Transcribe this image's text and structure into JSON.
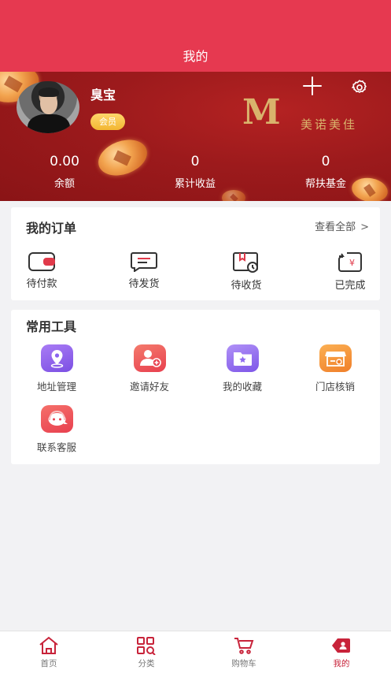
{
  "header": {
    "title": "我的"
  },
  "profile": {
    "name": "臭宝",
    "badge": "会员",
    "brand_letter": "M",
    "brand_name": "美诺美佳"
  },
  "stats": [
    {
      "value": "0.00",
      "label": "余额"
    },
    {
      "value": "0",
      "label": "累计收益"
    },
    {
      "value": "0",
      "label": "帮扶基金"
    }
  ],
  "orders": {
    "title": "我的订单",
    "view_all": "查看全部",
    "items": [
      {
        "label": "待付款",
        "icon": "wallet-icon"
      },
      {
        "label": "待发货",
        "icon": "message-box-icon"
      },
      {
        "label": "待收货",
        "icon": "package-clock-icon"
      },
      {
        "label": "已完成",
        "icon": "refund-yen-icon"
      }
    ]
  },
  "tools": {
    "title": "常用工具",
    "items": [
      {
        "label": "地址管理",
        "icon": "location-icon",
        "color": "#8a63f0"
      },
      {
        "label": "邀请好友",
        "icon": "add-friend-icon",
        "color": "#ef5a5e"
      },
      {
        "label": "我的收藏",
        "icon": "star-folder-icon",
        "color": "#9a77f2"
      },
      {
        "label": "门店核销",
        "icon": "store-icon",
        "color": "#f59a3a"
      },
      {
        "label": "联系客服",
        "icon": "customer-service-icon",
        "color": "#ee5656"
      }
    ]
  },
  "tabbar": {
    "items": [
      {
        "label": "首页",
        "icon": "home-icon"
      },
      {
        "label": "分类",
        "icon": "category-icon"
      },
      {
        "label": "购物车",
        "icon": "cart-icon"
      },
      {
        "label": "我的",
        "icon": "profile-tag-icon",
        "active": true
      }
    ]
  },
  "colors": {
    "header": "#e63950",
    "banner": "#9c1a1c",
    "accent": "#c8233a",
    "gold": "#d9b36c"
  }
}
